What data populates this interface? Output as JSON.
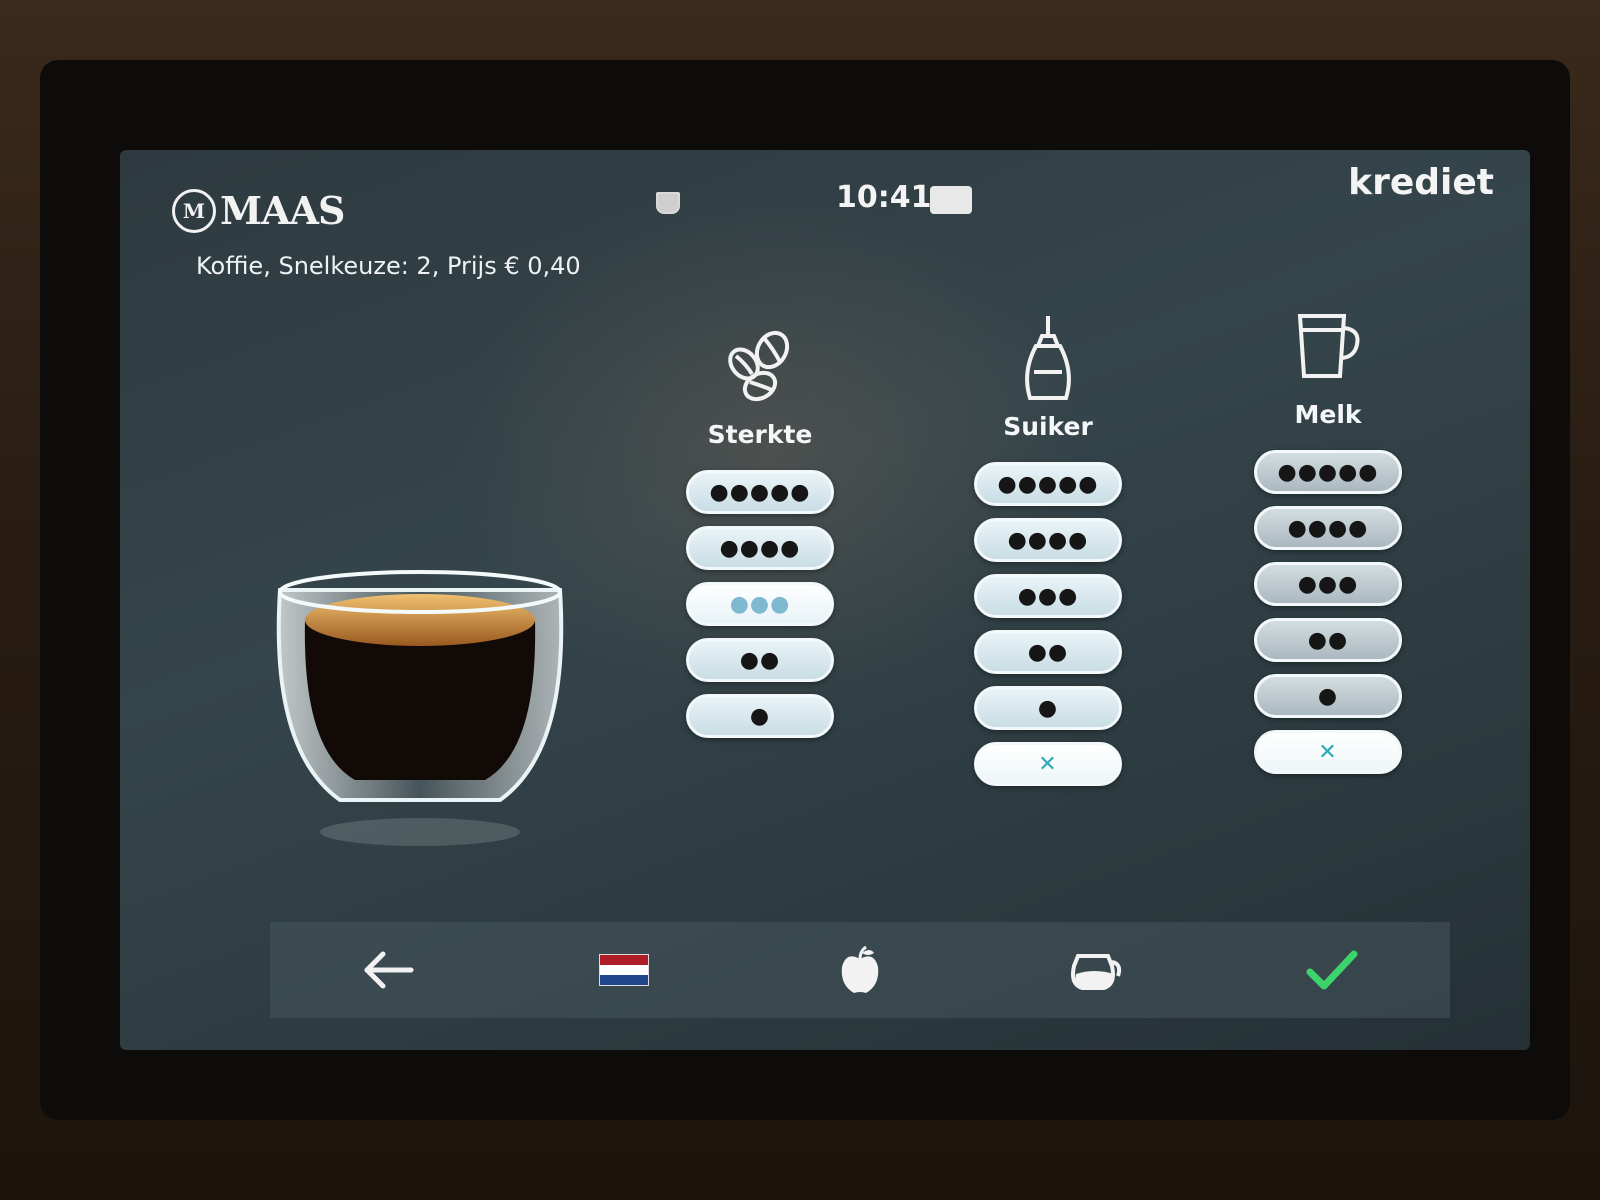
{
  "header": {
    "logo_text": "MAAS",
    "logo_mark": "M",
    "product_line": "Koffie, Snelkeuze: 2, Prijs € 0,40",
    "time": "10:41",
    "credit_label": "krediet"
  },
  "columns": [
    {
      "title": "Sterkte",
      "icon": "coffee-beans-icon",
      "options": [
        {
          "label": "●●●●●",
          "level": 5
        },
        {
          "label": "●●●●",
          "level": 4
        },
        {
          "label": "●●●",
          "level": 3,
          "selected": true
        },
        {
          "label": "●●",
          "level": 2
        },
        {
          "label": "●",
          "level": 1
        }
      ]
    },
    {
      "title": "Suiker",
      "icon": "sugar-dispenser-icon",
      "options": [
        {
          "label": "●●●●●",
          "level": 5
        },
        {
          "label": "●●●●",
          "level": 4
        },
        {
          "label": "●●●",
          "level": 3
        },
        {
          "label": "●●",
          "level": 2
        },
        {
          "label": "●",
          "level": 1
        },
        {
          "label": "✕",
          "level": 0,
          "selected": true
        }
      ]
    },
    {
      "title": "Melk",
      "icon": "milk-cup-icon",
      "options": [
        {
          "label": "●●●●●",
          "level": 5
        },
        {
          "label": "●●●●",
          "level": 4
        },
        {
          "label": "●●●",
          "level": 3
        },
        {
          "label": "●●",
          "level": 2
        },
        {
          "label": "●",
          "level": 1
        },
        {
          "label": "✕",
          "level": 0,
          "selected": true
        }
      ]
    }
  ],
  "bottom_bar": {
    "back_icon": "arrow-left-icon",
    "language_icon": "dutch-flag-icon",
    "nutrition_icon": "apple-icon",
    "jug_icon": "coffee-jug-icon",
    "confirm_icon": "checkmark-icon"
  },
  "colors": {
    "screen_bg": "#34454b",
    "option_bg": "#d7e8ee",
    "option_none_mark": "#2fa8b7",
    "confirm_green": "#3cd46a",
    "flag_red": "#ae1c28",
    "flag_blue": "#21468b"
  }
}
